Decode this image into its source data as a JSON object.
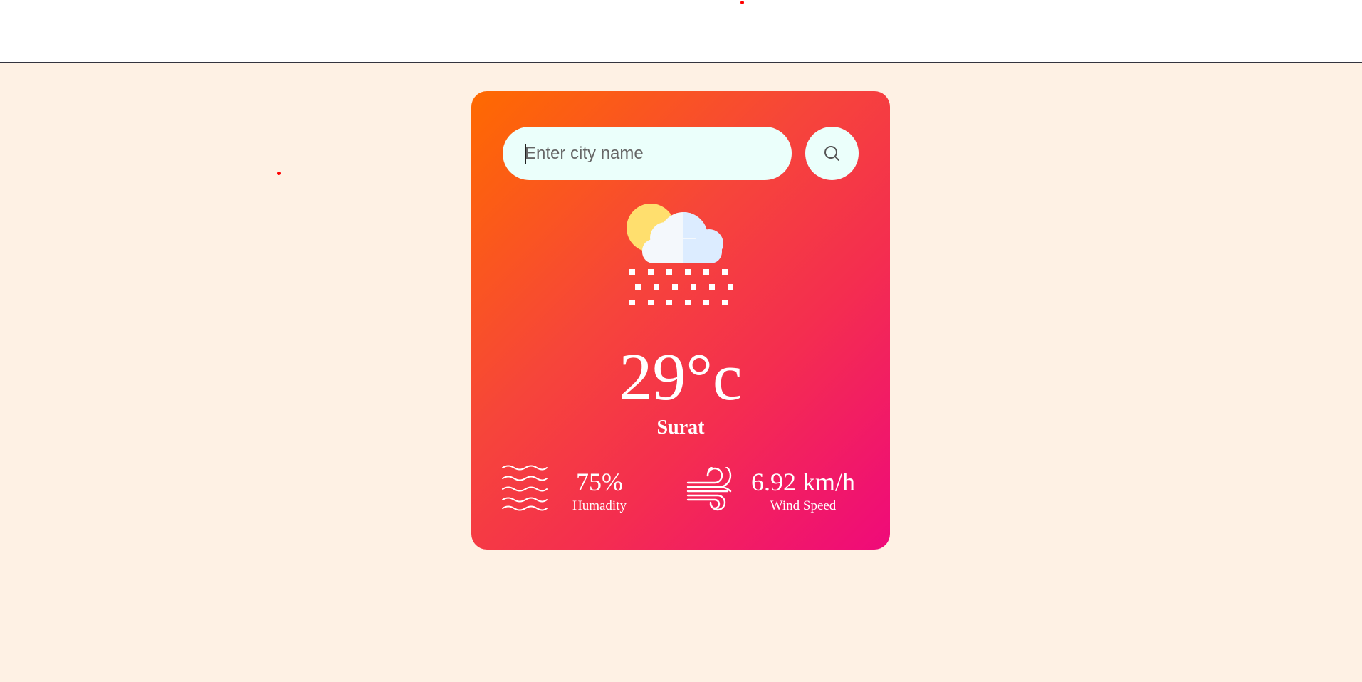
{
  "search": {
    "placeholder": "Enter city name",
    "value": ""
  },
  "weather": {
    "icon": "sun-cloud-snow-icon",
    "temperature": "29°c",
    "city": "Surat"
  },
  "details": {
    "humidity": {
      "value": "75%",
      "label": "Humadity",
      "icon": "waves-icon"
    },
    "wind": {
      "value": "6.92 km/h",
      "label": "Wind Speed",
      "icon": "wind-icon"
    }
  },
  "colors": {
    "page_background": "#fef1e4",
    "card_gradient_start": "#ff6a00",
    "card_gradient_end": "#ef0a7a",
    "input_background": "#ebfffb"
  }
}
